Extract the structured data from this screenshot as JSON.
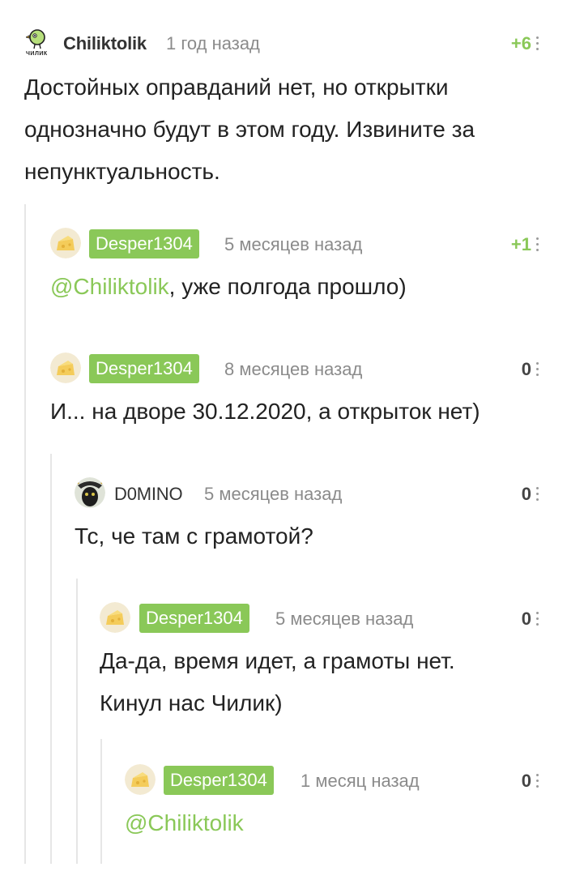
{
  "comments": [
    {
      "user": "Chiliktolik",
      "time": "1 год назад",
      "rating": "+6",
      "lines": [
        "Достойных оправданий нет, но открытки",
        "однозначно будут в этом году. Извините за",
        "непунктуальность."
      ],
      "avatar_caption": "ЧИЛИК"
    },
    {
      "user": "Desper1304",
      "time": "5 месяцев назад",
      "rating": "+1",
      "mention": "@Chiliktolik",
      "text": ", уже полгода прошло)"
    },
    {
      "user": "Desper1304",
      "time": "8 месяцев назад",
      "rating": "0",
      "text": "И... на дворе 30.12.2020, а открыток нет)"
    },
    {
      "user": "D0MINO",
      "time": "5 месяцев назад",
      "rating": "0",
      "text": "Тс, че там с грамотой?"
    },
    {
      "user": "Desper1304",
      "time": "5 месяцев назад",
      "rating": "0",
      "lines": [
        "Да-да, время идет, а грамоты нет.",
        "Кинул нас Чилик)"
      ]
    },
    {
      "user": "Desper1304",
      "time": "1 месяц назад",
      "rating": "0",
      "mention": "@Chiliktolik"
    }
  ],
  "colors": {
    "accent": "#8ac858",
    "muted": "#8b8b8b",
    "thread_line": "#e6e6e6"
  },
  "icons": {
    "more": "vertical-ellipsis-icon",
    "avatar_default": "cheese-avatar-icon"
  }
}
